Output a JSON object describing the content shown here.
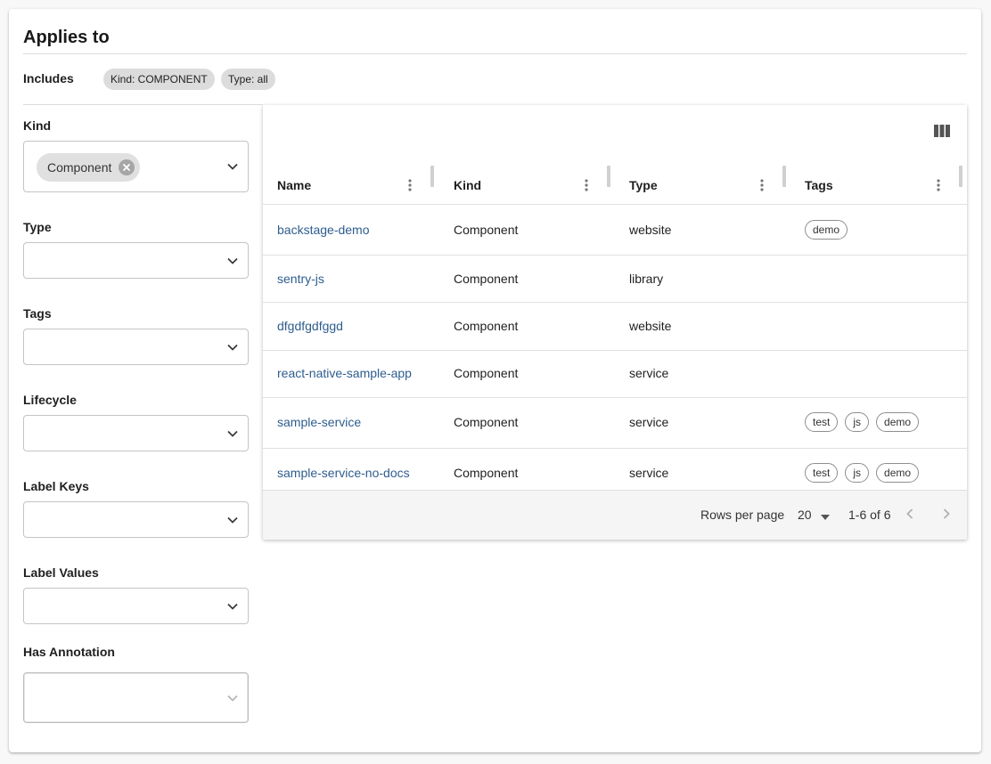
{
  "card": {
    "title": "Applies to"
  },
  "includes": {
    "label": "Includes",
    "chips": [
      "Kind: COMPONENT",
      "Type: all"
    ]
  },
  "filters": {
    "kind": {
      "label": "Kind",
      "selected_chip": "Component"
    },
    "type": {
      "label": "Type"
    },
    "tags": {
      "label": "Tags"
    },
    "lifecycle": {
      "label": "Lifecycle"
    },
    "label_keys": {
      "label": "Label Keys"
    },
    "label_values": {
      "label": "Label Values"
    },
    "has_annotation": {
      "label": "Has Annotation"
    }
  },
  "icons": {
    "columns": "view-column-icon",
    "dropdown": "chevron-down-icon",
    "chip_delete": "cancel-circle-icon",
    "column_menu": "more-vert-icon",
    "prev": "chevron-left-icon",
    "next": "chevron-right-icon"
  },
  "table": {
    "columns": [
      "Name",
      "Kind",
      "Type",
      "Tags"
    ],
    "rows": [
      {
        "name": "backstage-demo",
        "kind": "Component",
        "type": "website",
        "tags": [
          "demo"
        ]
      },
      {
        "name": "sentry-js",
        "kind": "Component",
        "type": "library",
        "tags": []
      },
      {
        "name": "dfgdfgdfggd",
        "kind": "Component",
        "type": "website",
        "tags": []
      },
      {
        "name": "react-native-sample-app",
        "kind": "Component",
        "type": "service",
        "tags": []
      },
      {
        "name": "sample-service",
        "kind": "Component",
        "type": "service",
        "tags": [
          "test",
          "js",
          "demo"
        ]
      },
      {
        "name": "sample-service-no-docs",
        "kind": "Component",
        "type": "service",
        "tags": [
          "test",
          "js",
          "demo"
        ]
      }
    ],
    "pagination": {
      "rows_per_page_label": "Rows per page",
      "rows_per_page": "20",
      "range": "1-6 of 6"
    }
  },
  "colors": {
    "link": "#2e5d8e",
    "chip_bg": "#dcdcdc",
    "border": "#c4c4c4"
  }
}
